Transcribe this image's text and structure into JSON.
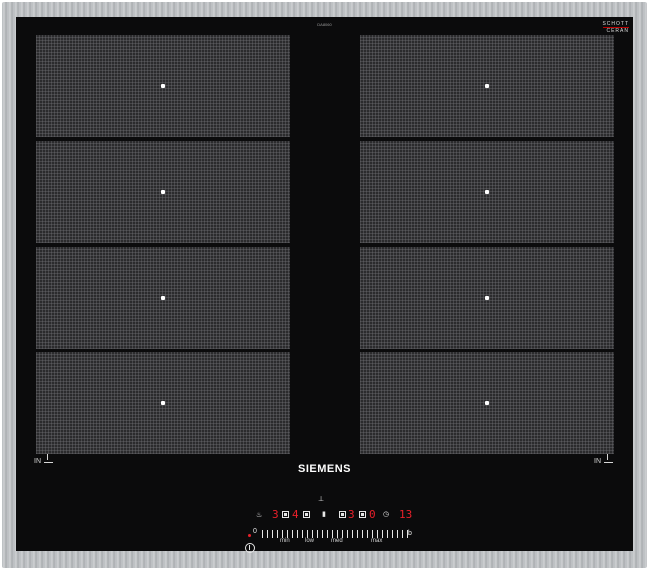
{
  "brand": "SIEMENS",
  "model_label": "DA8060",
  "glass_label": {
    "line1": "SCHOTT",
    "line2": "CERAN"
  },
  "zones": [
    {
      "id": "left-1"
    },
    {
      "id": "left-2"
    },
    {
      "id": "left-3"
    },
    {
      "id": "left-4"
    },
    {
      "id": "right-1"
    },
    {
      "id": "right-2"
    },
    {
      "id": "right-3"
    },
    {
      "id": "right-4"
    }
  ],
  "in_labels": {
    "left": "IN",
    "right": "IN"
  },
  "displays": {
    "zone_a": "3",
    "zone_b": "4",
    "zone_c": "3",
    "zone_d": "0",
    "timer": "13"
  },
  "slider": {
    "start": "0",
    "min": "min",
    "low": "low",
    "med": "med",
    "max": "max",
    "boost": "b"
  },
  "colors": {
    "display_red": "#e8202a",
    "glass": "#0b0b0c",
    "frame": "#c0c3c6"
  }
}
